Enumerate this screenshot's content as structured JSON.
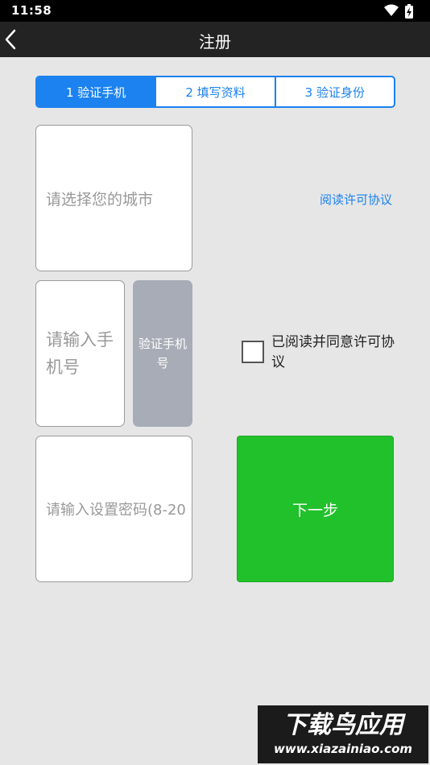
{
  "status_bar": {
    "time": "11:58",
    "icons": [
      "wifi-icon",
      "battery-charging-icon"
    ]
  },
  "title_bar": {
    "back_icon": "chevron-left-icon",
    "title": "注册"
  },
  "steps": [
    {
      "label": "1 验证手机",
      "active": true
    },
    {
      "label": "2 填写资料",
      "active": false
    },
    {
      "label": "3 验证身份",
      "active": false
    }
  ],
  "form": {
    "city_placeholder": "请选择您的城市",
    "phone_placeholder": "请输入手机号",
    "verify_button": "验证手机号",
    "password_placeholder": "请输入设置密码(8-20",
    "agreement_link": "阅读许可协议",
    "agree_label": "已阅读并同意许可协议",
    "agree_checked": false,
    "next_button": "下一步"
  },
  "watermark": {
    "title": "下载鸟应用",
    "url": "www.xiazainiao.com"
  },
  "colors": {
    "accent_blue": "#1b82f0",
    "next_green": "#21c12b",
    "verify_gray": "#a7acb6",
    "title_bar": "#232323",
    "background": "#e6e6e6"
  }
}
